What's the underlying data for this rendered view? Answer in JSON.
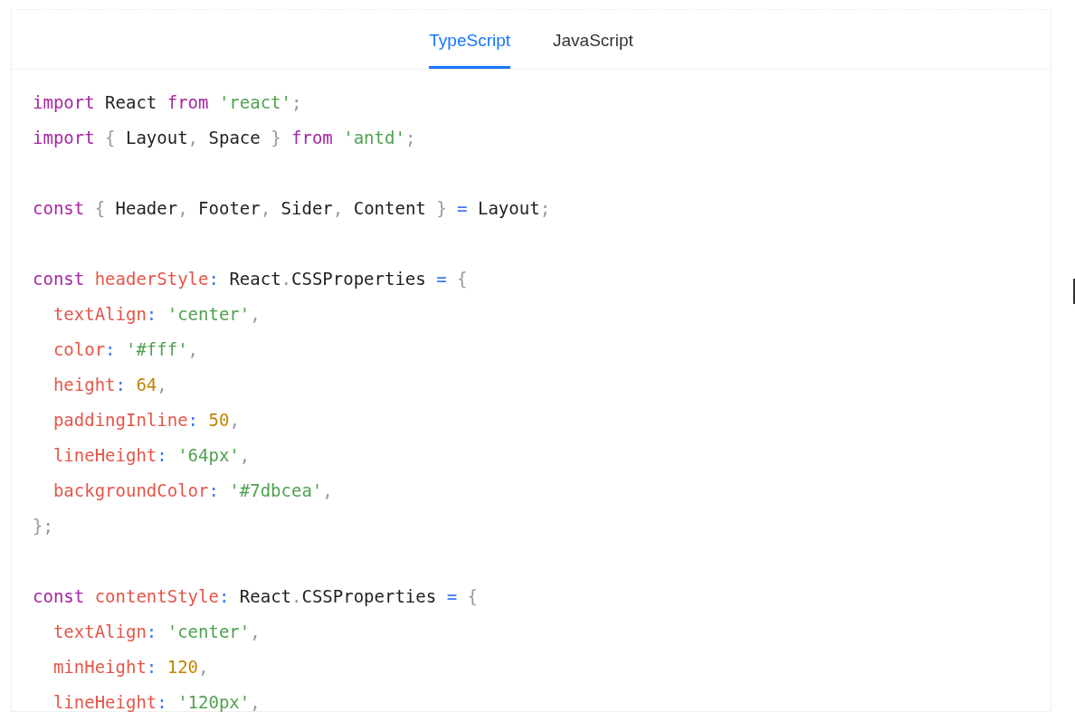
{
  "tabs": [
    {
      "label": "TypeScript",
      "selected": true
    },
    {
      "label": "JavaScript",
      "selected": false
    }
  ],
  "code_lines": [
    {
      "kind": "code",
      "tokens": [
        {
          "kind": "kw",
          "text": "import"
        },
        {
          "kind": "plain",
          "text": " React "
        },
        {
          "kind": "kw",
          "text": "from"
        },
        {
          "kind": "str",
          "text": " 'react'"
        },
        {
          "kind": "punct",
          "text": ";"
        }
      ]
    },
    {
      "kind": "code",
      "tokens": [
        {
          "kind": "kw",
          "text": "import"
        },
        {
          "kind": "punct",
          "text": " { "
        },
        {
          "kind": "plain",
          "text": "Layout"
        },
        {
          "kind": "punct",
          "text": ", "
        },
        {
          "kind": "plain",
          "text": "Space"
        },
        {
          "kind": "punct",
          "text": " } "
        },
        {
          "kind": "kw",
          "text": "from"
        },
        {
          "kind": "str",
          "text": " 'antd'"
        },
        {
          "kind": "punct",
          "text": ";"
        }
      ]
    },
    {
      "kind": "blank"
    },
    {
      "kind": "code",
      "tokens": [
        {
          "kind": "kw",
          "text": "const"
        },
        {
          "kind": "punct",
          "text": " { "
        },
        {
          "kind": "plain",
          "text": "Header"
        },
        {
          "kind": "punct",
          "text": ", "
        },
        {
          "kind": "plain",
          "text": "Footer"
        },
        {
          "kind": "punct",
          "text": ", "
        },
        {
          "kind": "plain",
          "text": "Sider"
        },
        {
          "kind": "punct",
          "text": ", "
        },
        {
          "kind": "plain",
          "text": "Content"
        },
        {
          "kind": "punct",
          "text": " } "
        },
        {
          "kind": "op",
          "text": "="
        },
        {
          "kind": "plain",
          "text": " Layout"
        },
        {
          "kind": "punct",
          "text": ";"
        }
      ]
    },
    {
      "kind": "blank"
    },
    {
      "kind": "code",
      "tokens": [
        {
          "kind": "kw",
          "text": "const"
        },
        {
          "kind": "prop",
          "text": " headerStyle"
        },
        {
          "kind": "op",
          "text": ":"
        },
        {
          "kind": "plain",
          "text": " React"
        },
        {
          "kind": "punct",
          "text": "."
        },
        {
          "kind": "plain",
          "text": "CSSProperties "
        },
        {
          "kind": "op",
          "text": "="
        },
        {
          "kind": "punct",
          "text": " {"
        }
      ]
    },
    {
      "kind": "code",
      "tokens": [
        {
          "kind": "prop",
          "text": "  textAlign"
        },
        {
          "kind": "op",
          "text": ":"
        },
        {
          "kind": "str",
          "text": " 'center'"
        },
        {
          "kind": "punct",
          "text": ","
        }
      ]
    },
    {
      "kind": "code",
      "tokens": [
        {
          "kind": "prop",
          "text": "  color"
        },
        {
          "kind": "op",
          "text": ":"
        },
        {
          "kind": "str",
          "text": " '#fff'"
        },
        {
          "kind": "punct",
          "text": ","
        }
      ]
    },
    {
      "kind": "code",
      "tokens": [
        {
          "kind": "prop",
          "text": "  height"
        },
        {
          "kind": "op",
          "text": ":"
        },
        {
          "kind": "num",
          "text": " 64"
        },
        {
          "kind": "punct",
          "text": ","
        }
      ]
    },
    {
      "kind": "code",
      "tokens": [
        {
          "kind": "prop",
          "text": "  paddingInline"
        },
        {
          "kind": "op",
          "text": ":"
        },
        {
          "kind": "num",
          "text": " 50"
        },
        {
          "kind": "punct",
          "text": ","
        }
      ]
    },
    {
      "kind": "code",
      "tokens": [
        {
          "kind": "prop",
          "text": "  lineHeight"
        },
        {
          "kind": "op",
          "text": ":"
        },
        {
          "kind": "str",
          "text": " '64px'"
        },
        {
          "kind": "punct",
          "text": ","
        }
      ]
    },
    {
      "kind": "code",
      "tokens": [
        {
          "kind": "prop",
          "text": "  backgroundColor"
        },
        {
          "kind": "op",
          "text": ":"
        },
        {
          "kind": "str",
          "text": " '#7dbcea'"
        },
        {
          "kind": "punct",
          "text": ","
        }
      ]
    },
    {
      "kind": "code",
      "tokens": [
        {
          "kind": "punct",
          "text": "};"
        }
      ]
    },
    {
      "kind": "blank"
    },
    {
      "kind": "code",
      "tokens": [
        {
          "kind": "kw",
          "text": "const"
        },
        {
          "kind": "prop",
          "text": " contentStyle"
        },
        {
          "kind": "op",
          "text": ":"
        },
        {
          "kind": "plain",
          "text": " React"
        },
        {
          "kind": "punct",
          "text": "."
        },
        {
          "kind": "plain",
          "text": "CSSProperties "
        },
        {
          "kind": "op",
          "text": "="
        },
        {
          "kind": "punct",
          "text": " {"
        }
      ]
    },
    {
      "kind": "code",
      "tokens": [
        {
          "kind": "prop",
          "text": "  textAlign"
        },
        {
          "kind": "op",
          "text": ":"
        },
        {
          "kind": "str",
          "text": " 'center'"
        },
        {
          "kind": "punct",
          "text": ","
        }
      ]
    },
    {
      "kind": "code",
      "tokens": [
        {
          "kind": "prop",
          "text": "  minHeight"
        },
        {
          "kind": "op",
          "text": ":"
        },
        {
          "kind": "num",
          "text": " 120"
        },
        {
          "kind": "punct",
          "text": ","
        }
      ]
    },
    {
      "kind": "code",
      "tokens": [
        {
          "kind": "prop",
          "text": "  lineHeight"
        },
        {
          "kind": "op",
          "text": ":"
        },
        {
          "kind": "str",
          "text": " '120px'"
        },
        {
          "kind": "punct",
          "text": ","
        }
      ]
    }
  ]
}
